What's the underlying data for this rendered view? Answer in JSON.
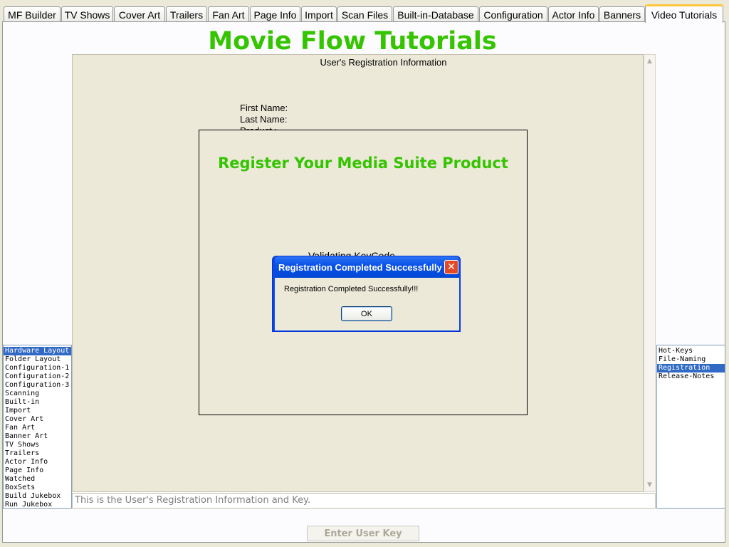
{
  "tabs": [
    {
      "label": "MF Builder"
    },
    {
      "label": "TV Shows"
    },
    {
      "label": "Cover Art"
    },
    {
      "label": "Trailers"
    },
    {
      "label": "Fan Art"
    },
    {
      "label": "Page Info"
    },
    {
      "label": "Import"
    },
    {
      "label": "Scan Files"
    },
    {
      "label": "Built-in-Database"
    },
    {
      "label": "Configuration"
    },
    {
      "label": "Actor Info"
    },
    {
      "label": "Banners"
    },
    {
      "label": "Video Tutorials",
      "active": true
    }
  ],
  "page": {
    "title": "Movie Flow Tutorials",
    "section_title": "User's Registration Information",
    "first_name_label": "First Name:",
    "last_name_label": "Last  Name:",
    "product_label": "Product      :",
    "hint": "This is the User's Registration Information and Key.",
    "enter_key_button": "Enter User Key"
  },
  "register_dialog": {
    "title": "Register Your Media Suite Product",
    "status": "Validating KeyCode"
  },
  "message_box": {
    "title": "Registration Completed Successfully",
    "message": "Registration Completed Successfully!!!",
    "ok_label": "OK",
    "close_icon": "close-icon"
  },
  "left_list": {
    "selected": "Hardware Layout",
    "items": [
      "Hardware Layout",
      "Folder Layout",
      "Configuration-1",
      "Configuration-2",
      "Configuration-3",
      "Scanning",
      "Built-in",
      "Import",
      "Cover Art",
      "Fan Art",
      "Banner Art",
      "TV Shows",
      "Trailers",
      "Actor Info",
      "Page Info",
      "Watched",
      "BoxSets",
      "Build Jukebox",
      "Run Jukebox"
    ]
  },
  "right_list": {
    "selected": "Registration",
    "items": [
      "Hot-Keys",
      "File-Naming",
      "Registration",
      "Release-Notes"
    ]
  },
  "colors": {
    "title_green": "#34c400",
    "selection_blue": "#316ac5",
    "dialog_titlebar_blue": "#0a52e8",
    "active_tab_accent": "#ffc73c"
  }
}
